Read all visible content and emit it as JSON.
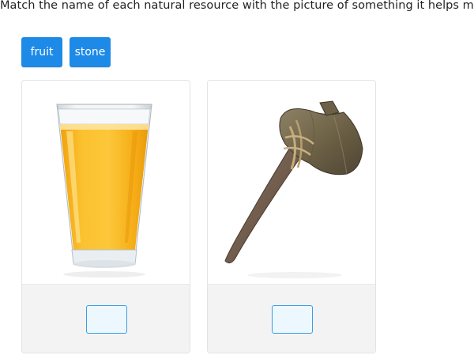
{
  "prompt": "Match the name of each natural resource with the picture of something it helps make.",
  "answer_tiles": [
    {
      "label": "fruit"
    },
    {
      "label": "stone"
    }
  ],
  "cards": [
    {
      "picture_icon": "orange-juice-glass-icon"
    },
    {
      "picture_icon": "stone-axe-icon"
    }
  ],
  "colors": {
    "tile_background": "#1d8ae8",
    "drop_border": "#3b9de6",
    "drop_background": "#ecf8fd",
    "card_footer": "#f3f3f3"
  }
}
